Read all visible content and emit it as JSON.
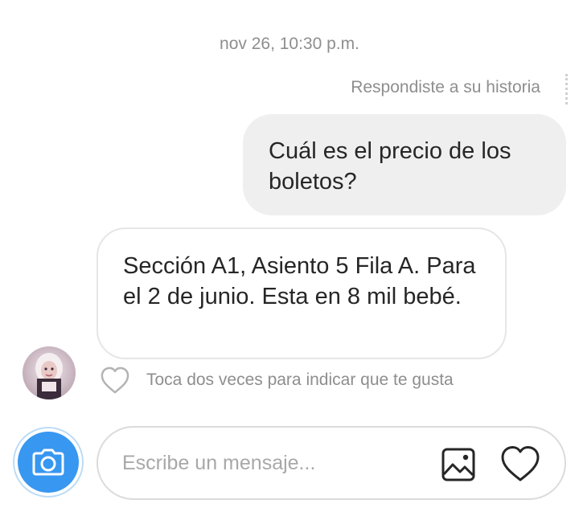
{
  "thread": {
    "timestamp": "nov 26, 10:30 p.m.",
    "story_reply_note": "Respondiste a su historia"
  },
  "messages": [
    {
      "direction": "outgoing",
      "text": "Cuál es el precio de los boletos?"
    },
    {
      "direction": "incoming",
      "text": "Sección A1, Asiento 5 Fila A. Para el 2 de junio. Esta en 8 mil bebé."
    }
  ],
  "like_hint": "Toca dos veces para indicar que te gusta",
  "composer": {
    "placeholder": "Escribe un mensaje..."
  },
  "icons": {
    "camera": "camera-icon",
    "gallery": "gallery-icon",
    "like": "heart-icon",
    "heart_send": "heart-icon"
  },
  "colors": {
    "accent": "#3897f0",
    "outgoing_bubble": "#efefef",
    "secondary_text": "#8e8e8e",
    "primary_text": "#262626"
  }
}
